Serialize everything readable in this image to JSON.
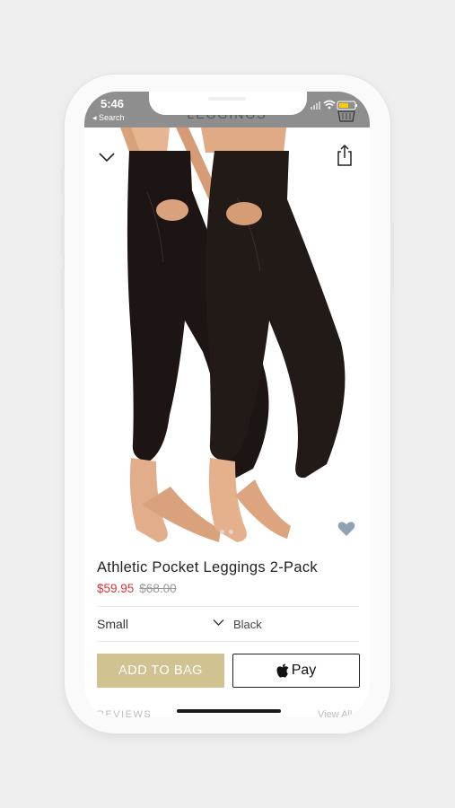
{
  "status_bar": {
    "time": "5:46",
    "back_label": "◂ Search",
    "battery_color": "#ffcc00"
  },
  "nav": {
    "title": "LEGGINGS",
    "collapse_icon": "chevron-down-icon",
    "share_icon": "share-icon",
    "cart_icon": "shopping-bag-icon"
  },
  "product": {
    "image": "black-leggings-photo",
    "carousel_pages": 2,
    "carousel_active": 1,
    "favorite_icon": "heart-icon",
    "title": "Athletic Pocket Leggings 2-Pack",
    "sale_price": "$59.95",
    "original_price": "$68.00"
  },
  "options": {
    "size": "Small",
    "color": "Black"
  },
  "actions": {
    "add_to_bag": "ADD TO BAG",
    "apple_pay": "Pay"
  },
  "footer": {
    "reviews": "REVIEWS",
    "view_all": "View All"
  },
  "colors": {
    "accent": "#d1c291",
    "sale": "#dd3333",
    "favorite": "#8fa2b3"
  }
}
